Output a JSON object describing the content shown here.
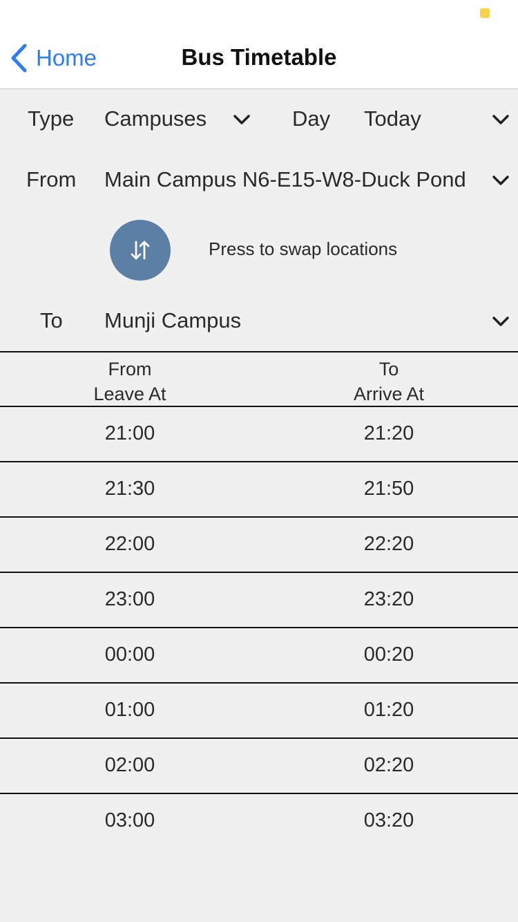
{
  "nav": {
    "back_label": "Home",
    "title": "Bus Timetable"
  },
  "form": {
    "type_label": "Type",
    "type_value": "Campuses",
    "day_label": "Day",
    "day_value": "Today",
    "from_label": "From",
    "from_value": "Main Campus N6-E15-W8-Duck Pond",
    "swap_hint": "Press to swap locations",
    "to_label": "To",
    "to_value": "Munji Campus"
  },
  "table": {
    "col1_line1": "From",
    "col1_line2": "Leave At",
    "col2_line1": "To",
    "col2_line2": "Arrive At",
    "rows": [
      {
        "leave": "21:00",
        "arrive": "21:20"
      },
      {
        "leave": "21:30",
        "arrive": "21:50"
      },
      {
        "leave": "22:00",
        "arrive": "22:20"
      },
      {
        "leave": "23:00",
        "arrive": "23:20"
      },
      {
        "leave": "00:00",
        "arrive": "00:20"
      },
      {
        "leave": "01:00",
        "arrive": "01:20"
      },
      {
        "leave": "02:00",
        "arrive": "02:20"
      },
      {
        "leave": "03:00",
        "arrive": "03:20"
      }
    ]
  },
  "colors": {
    "accent": "#2f7cf6",
    "swap_button": "#5c7fa6",
    "background": "#f0f0f0",
    "status_indicator": "#f7d34a"
  },
  "icons": [
    "chevron-left-icon",
    "chevron-down-icon",
    "swap-arrows-icon"
  ]
}
